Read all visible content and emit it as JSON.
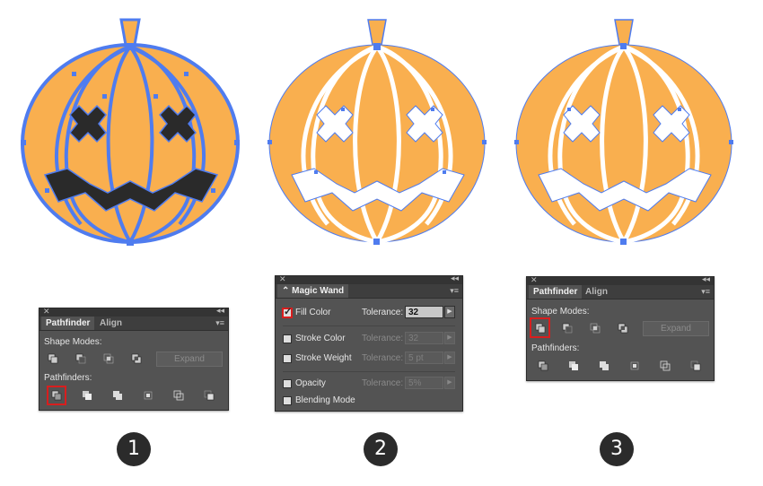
{
  "colors": {
    "pumpkin": "#F9AF4F",
    "selection": "#4F7CEF",
    "highlight": "#D81E1E"
  },
  "panel1": {
    "tabs": [
      "Pathfinder",
      "Align"
    ],
    "shape_modes_label": "Shape Modes:",
    "expand_label": "Expand",
    "pathfinders_label": "Pathfinders:",
    "icons": [
      "unite-icon",
      "minus-front-icon",
      "intersect-icon",
      "exclude-icon",
      "divide-icon",
      "trim-icon",
      "merge-icon",
      "crop-icon",
      "outline-icon",
      "minus-back-icon"
    ],
    "highlighted": "divide-icon"
  },
  "panel2": {
    "tab": "Magic Wand",
    "rows": [
      {
        "label": "Fill Color",
        "checked": true,
        "tolerance_label": "Tolerance:",
        "value": "32",
        "enabled": true
      },
      {
        "label": "Stroke Color",
        "checked": false,
        "tolerance_label": "Tolerance:",
        "value": "32",
        "enabled": false
      },
      {
        "label": "Stroke Weight",
        "checked": false,
        "tolerance_label": "Tolerance:",
        "value": "5 pt",
        "enabled": false
      },
      {
        "label": "Opacity",
        "checked": false,
        "tolerance_label": "Tolerance:",
        "value": "5%",
        "enabled": false
      },
      {
        "label": "Blending Mode",
        "checked": false
      }
    ]
  },
  "panel3": {
    "tabs": [
      "Pathfinder",
      "Align"
    ],
    "shape_modes_label": "Shape Modes:",
    "expand_label": "Expand",
    "pathfinders_label": "Pathfinders:",
    "highlighted": "unite-icon"
  },
  "steps": [
    "1",
    "2",
    "3"
  ]
}
